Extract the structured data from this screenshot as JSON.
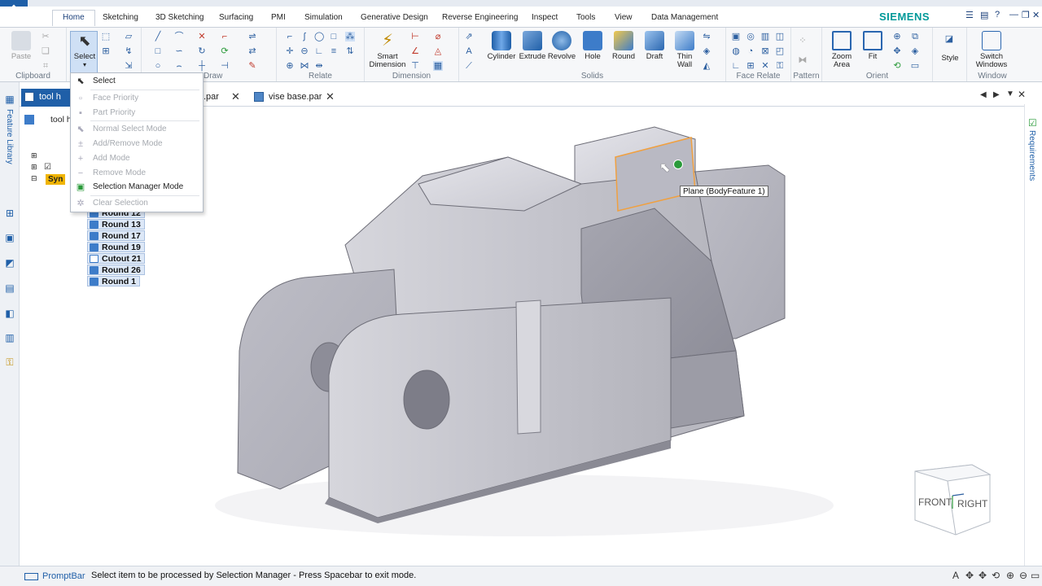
{
  "app": {
    "brand": "SIEMENS",
    "app_button_icon": "solid-edge-logo-icon"
  },
  "ribbon_tabs": [
    "Home",
    "Sketching",
    "3D Sketching",
    "Surfacing",
    "PMI",
    "Simulation",
    "Generative Design",
    "Reverse Engineering",
    "Inspect",
    "Tools",
    "View",
    "Data Management"
  ],
  "ribbon": {
    "clipboard": {
      "label": "Clipboard",
      "paste": "Paste"
    },
    "select": {
      "label": "Select"
    },
    "draw": {
      "label": "Draw"
    },
    "relate": {
      "label": "Relate"
    },
    "dimension": {
      "label": "Dimension",
      "smart_dimension_1": "Smart",
      "smart_dimension_2": "Dimension"
    },
    "solids": {
      "label": "Solids",
      "cylinder": "Cylinder",
      "extrude": "Extrude",
      "revolve": "Revolve",
      "hole": "Hole",
      "round": "Round",
      "draft": "Draft",
      "thin_wall_1": "Thin",
      "thin_wall_2": "Wall"
    },
    "face_relate": {
      "label": "Face Relate"
    },
    "pattern": {
      "label": "Pattern"
    },
    "orient": {
      "label": "Orient",
      "zoom_area_1": "Zoom",
      "zoom_area_2": "Area",
      "fit": "Fit"
    },
    "style": {
      "label": "Style"
    },
    "window": {
      "label": "Window",
      "switch_windows_1": "Switch",
      "switch_windows_2": "Windows"
    }
  },
  "doc_tabs": [
    {
      "label": "tool h"
    },
    {
      "label": ".par"
    },
    {
      "label": "vise base.par"
    }
  ],
  "tree": {
    "root": "tool h",
    "sync": "Syn",
    "items": [
      "Round 12",
      "Round 13",
      "Round 17",
      "Round 19",
      "Cutout 21",
      "Round 26",
      "Round 1"
    ]
  },
  "select_menu": {
    "items": [
      {
        "label": "Select",
        "enabled": true,
        "icon": "cursor-icon"
      },
      {
        "label": "Face Priority",
        "enabled": false,
        "icon": "face-priority-icon"
      },
      {
        "label": "Part Priority",
        "enabled": false,
        "icon": "part-priority-icon"
      },
      {
        "label": "Normal Select Mode",
        "enabled": false,
        "icon": "normal-select-icon"
      },
      {
        "label": "Add/Remove Mode",
        "enabled": false,
        "icon": "add-remove-icon"
      },
      {
        "label": "Add Mode",
        "enabled": false,
        "icon": "add-mode-icon"
      },
      {
        "label": "Remove Mode",
        "enabled": false,
        "icon": "remove-mode-icon"
      },
      {
        "label": "Selection Manager Mode",
        "enabled": true,
        "icon": "selection-manager-icon"
      },
      {
        "label": "Clear Selection",
        "enabled": false,
        "icon": "clear-selection-icon"
      }
    ]
  },
  "side": {
    "feature_library": "Feature Library",
    "requirements": "Requirements"
  },
  "viewport": {
    "tooltip": "Plane (BodyFeature 1)",
    "view_cube": {
      "front": "FRONT",
      "right": "RIGHT"
    }
  },
  "status": {
    "promptbar_label": "PromptBar",
    "prompt_text": "Select item to be processed by Selection Manager -  Press Spacebar to exit mode."
  },
  "colors": {
    "accent": "#1f5fa8",
    "brand": "#009999",
    "selection_highlight": "#f0a040",
    "part_surface": "#c8c8d0"
  }
}
